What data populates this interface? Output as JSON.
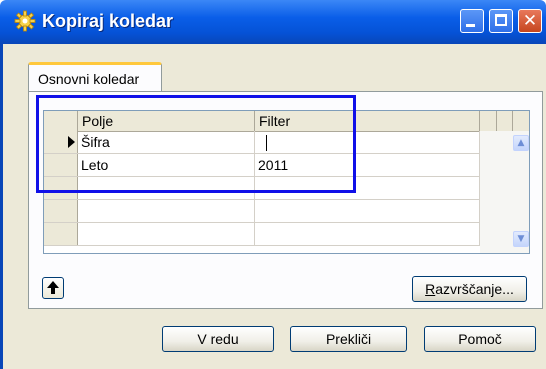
{
  "window": {
    "title": "Kopiraj koledar",
    "icon": "gear-icon",
    "controls": [
      "minimize-icon",
      "maximize-icon",
      "close-icon"
    ],
    "close_glyph": "✕"
  },
  "tab": {
    "label": "Osnovni koledar"
  },
  "grid": {
    "columns": [
      "Polje",
      "Filter"
    ],
    "rows": [
      {
        "field": "Šifra",
        "filter": "",
        "current": true
      },
      {
        "field": "Leto",
        "filter": "2011",
        "current": false
      },
      {
        "field": "",
        "filter": "",
        "current": false
      },
      {
        "field": "",
        "filter": "",
        "current": false
      },
      {
        "field": "",
        "filter": "",
        "current": false
      }
    ]
  },
  "buttons": {
    "up_glyph": "🠕",
    "sort_accel": "R",
    "sort_rest": "azvrščanje...",
    "ok": "V redu",
    "cancel": "Prekliči",
    "help": "Pomoč"
  },
  "colors": {
    "title_bar": "#0a5ee8",
    "highlight_box": "#1010e8",
    "tab_accent": "#ffc83c",
    "dialog_bg": "#ece9d8"
  }
}
